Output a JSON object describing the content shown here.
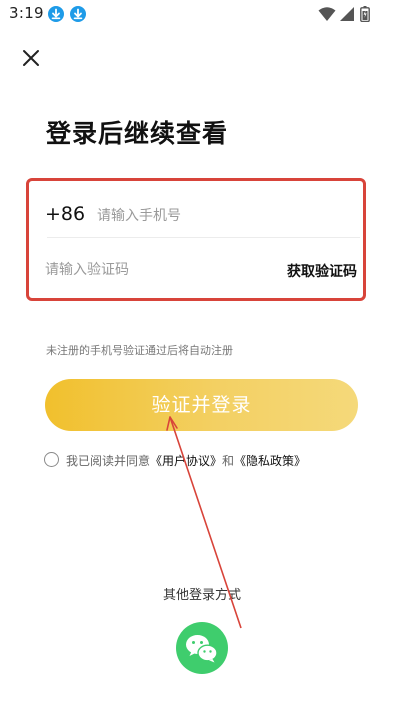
{
  "status_bar": {
    "time": "3:19",
    "icons": [
      "download-icon",
      "download-icon",
      "wifi-icon",
      "signal-icon",
      "battery-icon"
    ]
  },
  "header": {
    "close_icon": "close-icon"
  },
  "page": {
    "title": "登录后继续查看"
  },
  "form": {
    "country_code": "+86",
    "phone_placeholder": "请输入手机号",
    "phone_value": "",
    "code_placeholder": "请输入验证码",
    "code_value": "",
    "get_code_label": "获取验证码"
  },
  "hint": "未注册的手机号验证通过后将自动注册",
  "login_button": {
    "label": "验证并登录"
  },
  "agreement": {
    "checked": false,
    "prefix": "我已阅读并同意",
    "user_agreement": "《用户协议》",
    "conjunction": "和",
    "privacy_policy": "《隐私政策》"
  },
  "other_login": {
    "label": "其他登录方式",
    "wechat_icon": "wechat-icon"
  },
  "colors": {
    "accent_gradient_start": "#f1c02d",
    "accent_gradient_end": "#f5d97a",
    "annotation_red": "#d8443a",
    "wechat_green": "#3fcd6d",
    "status_download_blue": "#1e9be8"
  }
}
